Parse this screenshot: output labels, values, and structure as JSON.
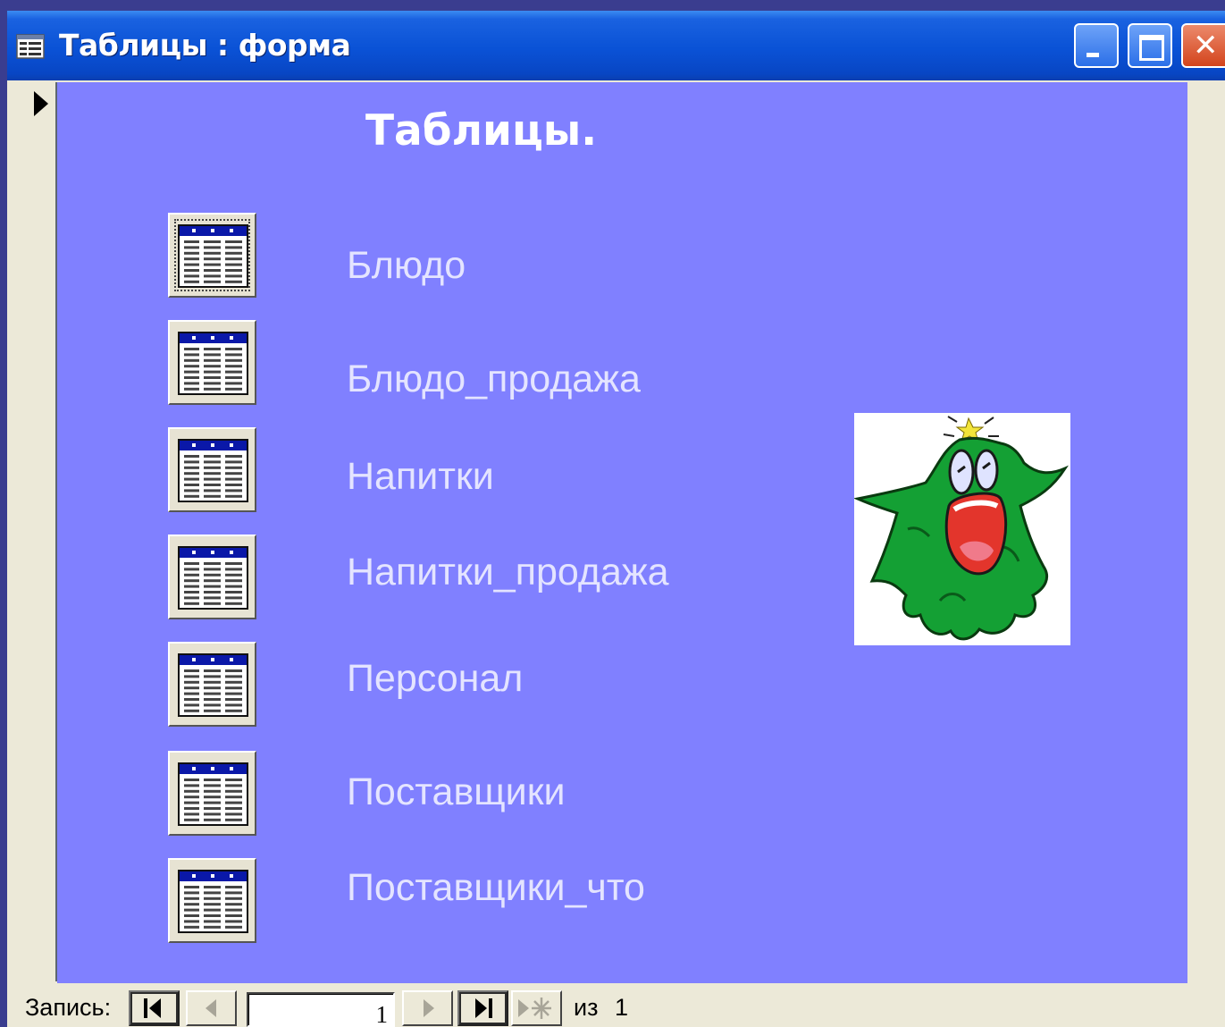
{
  "window": {
    "title": "Таблицы : форма"
  },
  "form": {
    "heading": "Таблицы.",
    "tables": [
      {
        "label": "Блюдо",
        "focused": true
      },
      {
        "label": "Блюдо_продажа"
      },
      {
        "label": "Напитки"
      },
      {
        "label": "Напитки_продажа"
      },
      {
        "label": "Персонал"
      },
      {
        "label": "Поставщики"
      },
      {
        "label": "Поставщики_что"
      }
    ],
    "image": "christmas-tree-cartoon"
  },
  "navigation": {
    "label": "Запись:",
    "current_record": "1",
    "of_label": "из",
    "total_records": "1"
  },
  "colors": {
    "form_background": "#8080ff",
    "titlebar": "#0a52d6",
    "label_text": "#e4e4ff"
  }
}
